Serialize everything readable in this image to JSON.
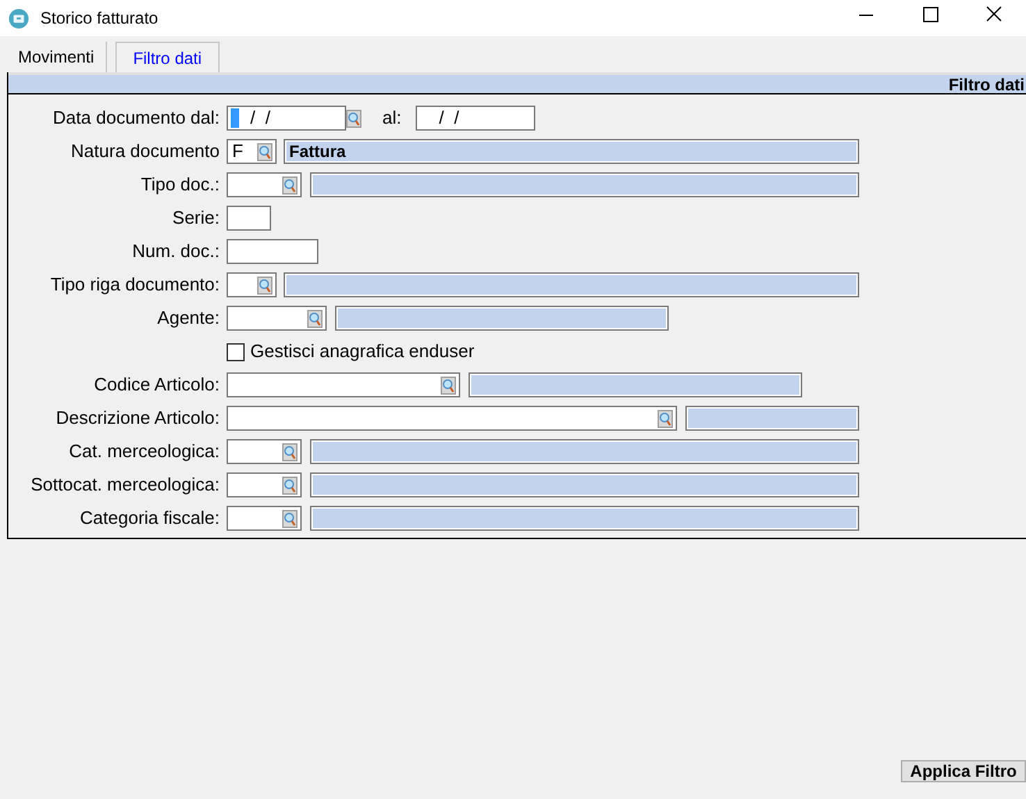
{
  "window": {
    "title": "Storico fatturato"
  },
  "tabs": [
    {
      "label": "Movimenti",
      "selected": false
    },
    {
      "label": "Filtro dati",
      "selected": true
    }
  ],
  "panel": {
    "title": "Filtro dati"
  },
  "rows": [
    {
      "kind": "date_range",
      "label": "Data documento dal:",
      "from": {
        "value": "/  /",
        "focused": true
      },
      "to_label": "al:",
      "to": {
        "value": "/  /",
        "focused": false
      }
    },
    {
      "kind": "lookup",
      "label": "Natura documento",
      "code": "F",
      "description": "Fattura"
    },
    {
      "kind": "lookup",
      "label": "Tipo doc.:"
    },
    {
      "kind": "text",
      "label": "Serie:"
    },
    {
      "kind": "text",
      "label": "Num. doc.:"
    },
    {
      "kind": "lookup",
      "label": "Tipo riga documento:"
    },
    {
      "kind": "lookup",
      "label": "Agente:"
    },
    {
      "kind": "checkbox",
      "label": "Gestisci anagrafica enduser",
      "checked": false
    },
    {
      "kind": "lookup",
      "label": "Codice Articolo:"
    },
    {
      "kind": "lookup",
      "label": "Descrizione Articolo:"
    },
    {
      "kind": "lookup",
      "label": "Cat. merceologica:"
    },
    {
      "kind": "lookup",
      "label": "Sottocat. merceologica:"
    },
    {
      "kind": "lookup",
      "label": "Categoria fiscale:"
    }
  ],
  "apply_button": "Applica Filtro"
}
